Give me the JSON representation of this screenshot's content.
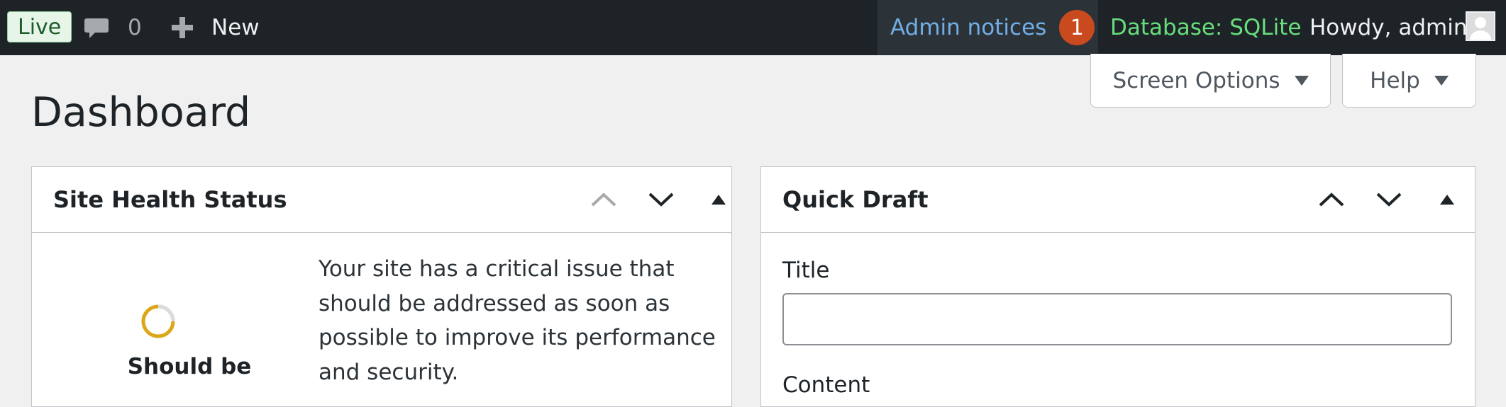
{
  "adminbar": {
    "live_label": "Live",
    "comments_count": "0",
    "new_label": "New",
    "admin_notices_label": "Admin notices",
    "admin_notices_count": "1",
    "database_label": "Database: SQLite",
    "howdy_label": "Howdy, admin"
  },
  "screen_meta": {
    "screen_options_label": "Screen Options",
    "help_label": "Help"
  },
  "page": {
    "title": "Dashboard"
  },
  "site_health": {
    "title": "Site Health Status",
    "status_label": "Should be",
    "description": "Your site has a critical issue that should be addressed as soon as possible to improve its performance and security."
  },
  "quick_draft": {
    "title": "Quick Draft",
    "title_field_label": "Title",
    "title_value": "",
    "content_field_label": "Content"
  },
  "colors": {
    "adminbar_bg": "#1d2327",
    "notices_text": "#72aee6",
    "notice_badge": "#ca4a1f",
    "database_text": "#68de7c",
    "spinner_progress": "#dba617"
  },
  "icons": {
    "comments": "speech-bubble-icon",
    "new": "plus-icon",
    "avatar": "avatar-icon",
    "move_up": "chevron-up-icon",
    "move_down": "chevron-down-icon",
    "toggle": "triangle-up-icon"
  }
}
